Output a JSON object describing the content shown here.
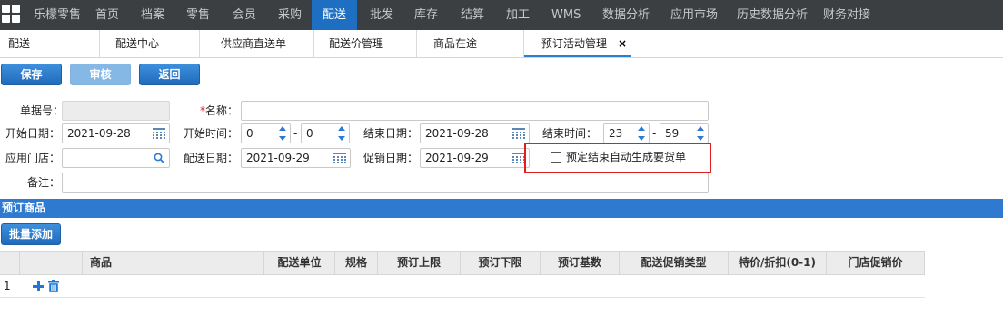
{
  "nav": {
    "items": [
      "乐檬零售",
      "首页",
      "档案",
      "零售",
      "会员",
      "采购",
      "配送",
      "批发",
      "库存",
      "结算",
      "加工",
      "WMS",
      "数据分析",
      "应用市场",
      "历史数据分析",
      "财务对接"
    ],
    "active": "配送"
  },
  "tabs": [
    "配送",
    "配送中心",
    "供应商直送单",
    "配送价管理",
    "商品在途",
    "预订活动管理"
  ],
  "active_tab": "预订活动管理",
  "toolbar": {
    "save": "保存",
    "review": "审核",
    "back": "返回"
  },
  "form": {
    "order_no_label": "单据号：",
    "order_no_value": "",
    "name_required_mark": "*",
    "name_label": "名称：",
    "name_value": "",
    "start_date_label": "开始日期：",
    "start_date_value": "2021-09-28",
    "start_time_label": "开始时间：",
    "start_hour": "0",
    "start_minute": "0",
    "end_date_label": "结束日期：",
    "end_date_value": "2021-09-28",
    "end_time_label": "结束时间：",
    "end_hour": "23",
    "end_minute": "59",
    "store_label": "应用门店：",
    "store_value": "",
    "delivery_date_label": "配送日期：",
    "delivery_date_value": "2021-09-29",
    "promo_date_label": "促销日期：",
    "promo_date_value": "2021-09-29",
    "auto_checkbox_label": "预定结束自动生成要货单",
    "auto_checkbox_checked": false,
    "remark_label": "备注：",
    "remark_value": "",
    "time_separator": "-"
  },
  "section": {
    "title": "预订商品",
    "batch_add": "批量添加"
  },
  "table": {
    "columns": [
      "商品",
      "配送单位",
      "规格",
      "预订上限",
      "预订下限",
      "预订基数",
      "配送促销类型",
      "特价/折扣(0-1)",
      "门店促销价"
    ],
    "rows": [
      {
        "index": "1"
      }
    ]
  },
  "colors": {
    "nav_bg": "#3c3f42",
    "accent": "#1e6fc2",
    "section_bar": "#2d7ad0",
    "highlight": "#e0201e"
  }
}
